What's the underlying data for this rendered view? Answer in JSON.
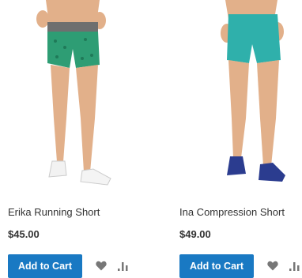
{
  "products": [
    {
      "name": "Erika Running Short",
      "price": "$45.00",
      "add_to_cart": "Add to Cart",
      "image_icon": "model-green-running-shorts",
      "wishlist_icon": "heart-icon",
      "compare_icon": "compare-bars-icon"
    },
    {
      "name": "Ina Compression Short",
      "price": "$49.00",
      "add_to_cart": "Add to Cart",
      "image_icon": "model-teal-compression-shorts",
      "wishlist_icon": "heart-icon",
      "compare_icon": "compare-bars-icon"
    }
  ],
  "colors": {
    "button": "#1979c3",
    "icon": "#777777",
    "shorts_green": "#2e9d74",
    "shorts_teal": "#2fb0ab",
    "waistband": "#6f6f6f",
    "skin": "#e2b08a"
  }
}
